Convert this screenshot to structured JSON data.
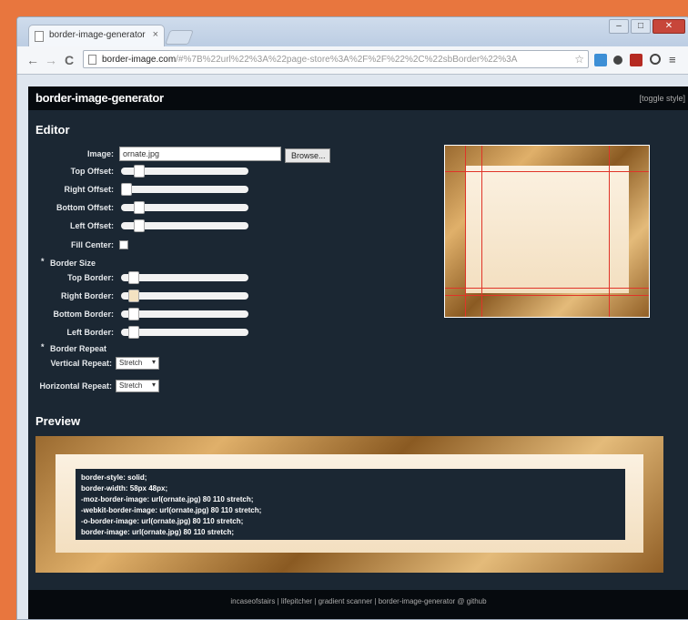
{
  "browser": {
    "tab_title": "border-image-generator",
    "tab_close": "×",
    "url_host": "border-image.com",
    "url_rest": "/#%7B%22url%22%3A%22page-store%3A%2F%2F%22%2C%22sbBorder%22%3A",
    "back_glyph": "←",
    "forward_glyph": "→",
    "reload_glyph": "C",
    "minimize_glyph": "–",
    "maximize_glyph": "□",
    "close_glyph": "✕",
    "star_glyph": "☆",
    "menu_glyph": "≡"
  },
  "header": {
    "title": "border-image-generator",
    "toggle_label": "[toggle style]"
  },
  "editor": {
    "heading": "Editor",
    "image_label": "Image:",
    "image_value": "ornate.jpg",
    "browse_label": "Browse...",
    "offsets": [
      {
        "label": "Top Offset:",
        "value": 0.17
      },
      {
        "label": "Right Offset:",
        "value": 0.0
      },
      {
        "label": "Bottom Offset:",
        "value": 0.17
      },
      {
        "label": "Left Offset:",
        "value": 0.17
      }
    ],
    "fill_center_label": "Fill Center:",
    "border_size_heading": "Border Size",
    "border_size_bullet": "*",
    "borders": [
      {
        "label": "Top Border:",
        "value": 0.07
      },
      {
        "label": "Right Border:",
        "value": 0.07
      },
      {
        "label": "Bottom Border:",
        "value": 0.07
      },
      {
        "label": "Left Border:",
        "value": 0.07
      }
    ],
    "border_repeat_heading": "Border Repeat",
    "border_repeat_bullet": "*",
    "vertical_repeat_label": "Vertical Repeat:",
    "vertical_repeat_value": "Stretch",
    "horizontal_repeat_label": "Horizontal Repeat:",
    "horizontal_repeat_value": "Stretch"
  },
  "preview": {
    "heading": "Preview",
    "code_lines": [
      "border-style: solid;",
      "border-width: 58px 48px;",
      "-moz-border-image: url(ornate.jpg) 80 110 stretch;",
      "-webkit-border-image: url(ornate.jpg) 80 110 stretch;",
      "-o-border-image: url(ornate.jpg) 80 110 stretch;",
      "border-image: url(ornate.jpg) 80 110 stretch;"
    ]
  },
  "footer": {
    "text": "incaseofstairs | lifepitcher | gradient scanner | border-image-generator @ github"
  },
  "colors": {
    "page_bg": "#1b2733",
    "header_bg": "#060a0e",
    "guide": "#e03428",
    "outer_bg": "#e8763e"
  }
}
